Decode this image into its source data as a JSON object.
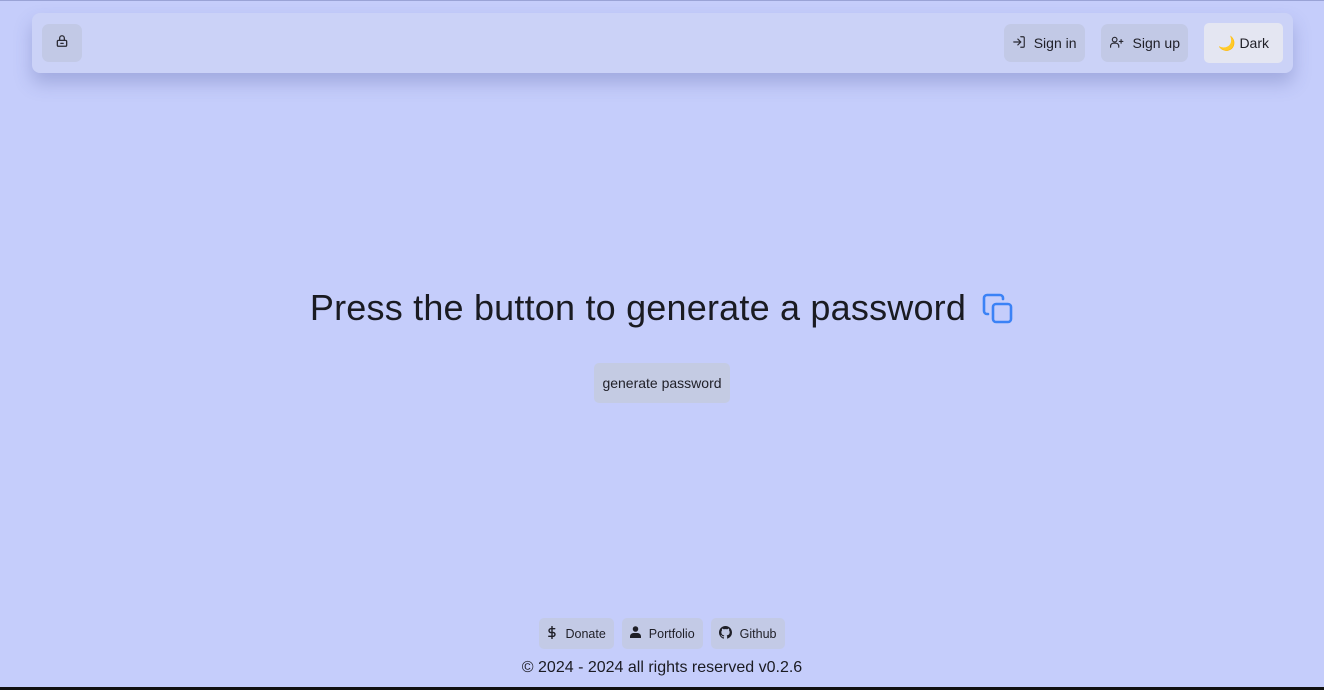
{
  "header": {
    "lock_icon": "lock-icon",
    "signin_label": "Sign in",
    "signin_icon": "sign-in-icon",
    "signup_label": "Sign up",
    "signup_icon": "user-plus-icon",
    "theme_label": "Dark",
    "theme_icon": "🌙"
  },
  "main": {
    "headline": "Press the button to generate a password",
    "copy_icon": "copy-icon",
    "generate_label": "generate password"
  },
  "footer": {
    "links": [
      {
        "label": "Donate",
        "icon": "dollar-icon"
      },
      {
        "label": "Portfolio",
        "icon": "user-icon"
      },
      {
        "label": "Github",
        "icon": "github-icon"
      }
    ],
    "copyright": "© 2024 - 2024 all rights reserved v0.2.6"
  },
  "colors": {
    "background": "#c5cdfb",
    "accent": "#3b82f6"
  }
}
